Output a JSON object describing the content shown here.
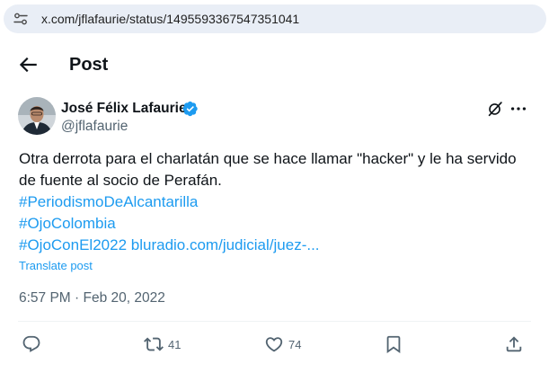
{
  "browser": {
    "url": "x.com/jflafaurie/status/1495593367547351041"
  },
  "header": {
    "title": "Post"
  },
  "post": {
    "author_name": "José Félix Lafaurie",
    "author_handle": "@jflafaurie",
    "text_lines": [
      "Otra derrota para el charlatán que se hace llamar \"hacker\" y le ha servido",
      "de fuente al socio de Perafán."
    ],
    "hashtag_1": "#PeriodismoDeAlcantarilla",
    "hashtag_2": "#OjoColombia",
    "hashtag_3": "#OjoConEl2022",
    "link_text": "bluradio.com/judicial/juez-...",
    "translate_label": "Translate post",
    "timestamp": "6:57 PM · Feb 20, 2022"
  },
  "actions": {
    "reply_count": "",
    "repost_count": "41",
    "like_count": "74"
  },
  "colors": {
    "accent": "#1d9bf0",
    "secondary_text": "#536471",
    "url_bar": "#e9eef6"
  },
  "icons": [
    "site-settings-icon",
    "back-arrow-icon",
    "verified-badge-icon",
    "grok-icon",
    "more-icon",
    "reply-icon",
    "repost-icon",
    "like-icon",
    "bookmark-icon",
    "share-icon"
  ]
}
